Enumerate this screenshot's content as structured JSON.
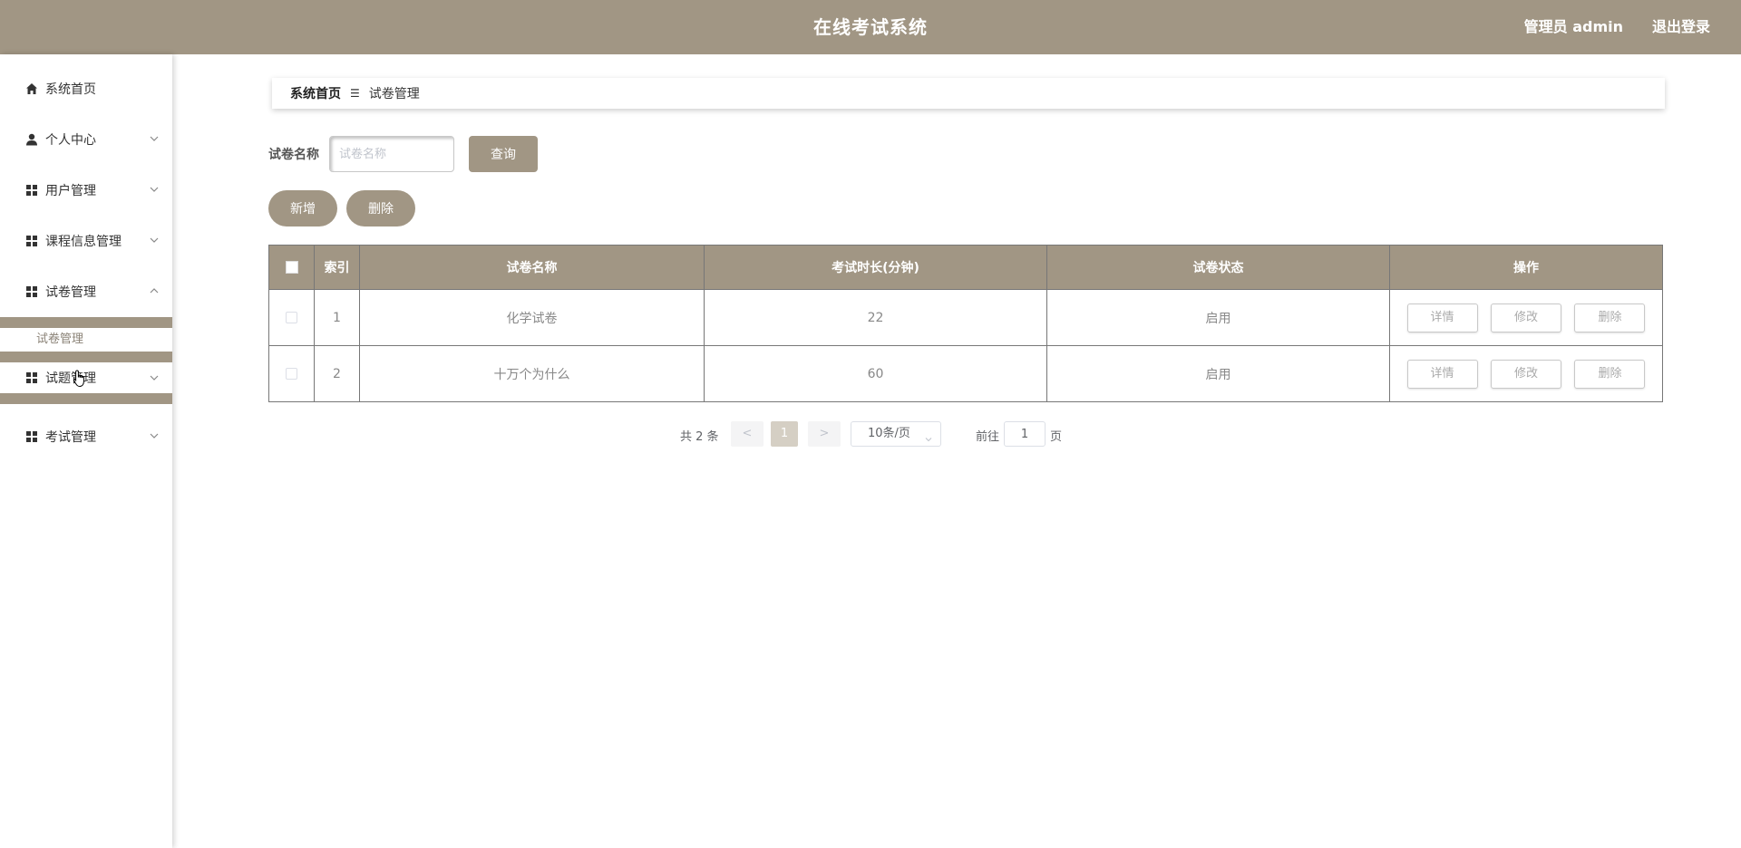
{
  "header": {
    "title": "在线考试系统",
    "user": "管理员 admin",
    "logout": "退出登录"
  },
  "sidebar": {
    "items": [
      {
        "label": "系统首页",
        "icon": "home-icon"
      },
      {
        "label": "个人中心",
        "icon": "person-icon"
      },
      {
        "label": "用户管理",
        "icon": "grid-icon"
      },
      {
        "label": "课程信息管理",
        "icon": "grid-icon"
      },
      {
        "label": "试卷管理",
        "icon": "grid-icon"
      },
      {
        "label": "试题管理",
        "icon": "grid-icon"
      },
      {
        "label": "考试管理",
        "icon": "grid-icon"
      }
    ],
    "sub_items": [
      {
        "label": "试卷管理"
      }
    ]
  },
  "breadcrumb": {
    "home": "系统首页",
    "current": "试卷管理"
  },
  "search": {
    "label": "试卷名称",
    "placeholder": "试卷名称",
    "button": "查询"
  },
  "actions": {
    "add": "新增",
    "delete": "删除"
  },
  "table": {
    "columns": [
      "索引",
      "试卷名称",
      "考试时长(分钟)",
      "试卷状态",
      "操作"
    ],
    "rows": [
      {
        "index": "1",
        "name": "化学试卷",
        "duration": "22",
        "status": "启用"
      },
      {
        "index": "2",
        "name": "十万个为什么",
        "duration": "60",
        "status": "启用"
      }
    ],
    "row_actions": {
      "detail": "详情",
      "edit": "修改",
      "delete": "删除"
    }
  },
  "pagination": {
    "total": "共 2 条",
    "prev": "<",
    "current_page": "1",
    "next": ">",
    "page_size": "10条/页",
    "goto_label": "前往",
    "goto_value": "1",
    "page_unit": "页"
  },
  "colors": {
    "accent": "#a19684"
  }
}
